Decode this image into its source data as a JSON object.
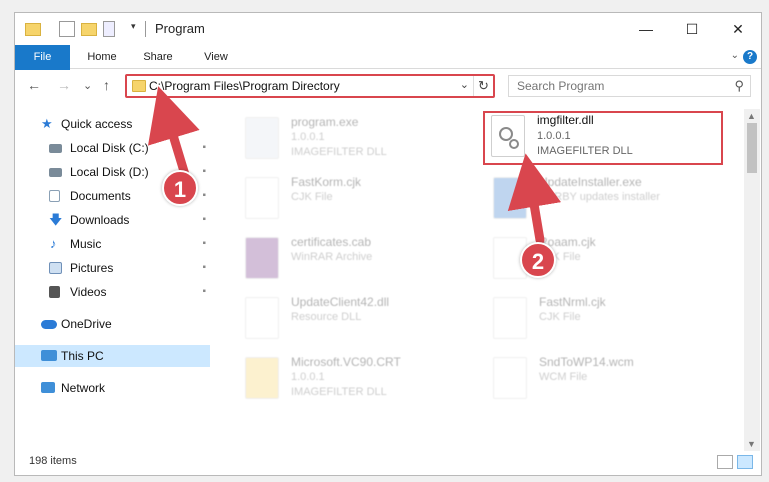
{
  "window": {
    "title": "Program",
    "buttons": {
      "minimize": "—",
      "maximize": "☐",
      "close": "✕"
    }
  },
  "ribbon": {
    "tabs": [
      "File",
      "Home",
      "Share",
      "View"
    ],
    "expand": "⌄",
    "help": "?"
  },
  "nav": {
    "back": "←",
    "forward": "→",
    "recent": "⌄",
    "up": "↑",
    "address": "C:\\Program Files\\Program Directory",
    "dropdown": "⌄",
    "refresh": "↻"
  },
  "search": {
    "placeholder": "Search Program",
    "icon": "⚲"
  },
  "sidebar": {
    "items": [
      {
        "label": "Quick access",
        "icon": "star-icon",
        "color": "#2b7bd6",
        "pinned": false
      },
      {
        "label": "Local Disk (C:)",
        "icon": "drive-icon",
        "color": "#7a8b99",
        "pinned": true
      },
      {
        "label": "Local Disk (D:)",
        "icon": "drive-icon",
        "color": "#7a8b99",
        "pinned": true
      },
      {
        "label": "Documents",
        "icon": "documents-icon",
        "color": "#8aa0b5",
        "pinned": true
      },
      {
        "label": "Downloads",
        "icon": "downloads-icon",
        "color": "#2b7bd6",
        "pinned": true
      },
      {
        "label": "Music",
        "icon": "music-icon",
        "color": "#2b7bd6",
        "pinned": true
      },
      {
        "label": "Pictures",
        "icon": "pictures-icon",
        "color": "#6f90b8",
        "pinned": true
      },
      {
        "label": "Videos",
        "icon": "videos-icon",
        "color": "#555555",
        "pinned": true
      },
      {
        "label": "OneDrive",
        "icon": "cloud-icon",
        "color": "#2b7bd6",
        "pinned": false
      },
      {
        "label": "This PC",
        "icon": "pc-icon",
        "color": "#3f8fd8",
        "pinned": false
      },
      {
        "label": "Network",
        "icon": "network-icon",
        "color": "#3f8fd8",
        "pinned": false
      }
    ],
    "pin_glyph": "📌"
  },
  "files": [
    {
      "name": "program.exe",
      "line2": "1.0.0.1",
      "line3": "IMAGEFILTER DLL",
      "icon": "exe-icon"
    },
    {
      "name": "imgfilter.dll",
      "line2": "1.0.0.1",
      "line3": "IMAGEFILTER DLL",
      "icon": "dll-gear-icon"
    },
    {
      "name": "FastKorm.cjk",
      "line2": "CJK File",
      "line3": "",
      "icon": "blank-file-icon"
    },
    {
      "name": "UpdateInstaller.exe",
      "line2": "RARBY updates installer",
      "line3": "",
      "icon": "installer-icon"
    },
    {
      "name": "certificates.cab",
      "line2": "WinRAR Archive",
      "line3": "",
      "icon": "archive-icon"
    },
    {
      "name": "Roaam.cjk",
      "line2": "CJK File",
      "line3": "",
      "icon": "blank-file-icon"
    },
    {
      "name": "UpdateClient42.dll",
      "line2": "Resource DLL",
      "line3": "",
      "icon": "dll-gear-icon"
    },
    {
      "name": "FastNrml.cjk",
      "line2": "CJK File",
      "line3": "",
      "icon": "blank-file-icon"
    },
    {
      "name": "Microsoft.VC90.CRT",
      "line2": "1.0.0.1",
      "line3": "IMAGEFILTER DLL",
      "icon": "folder-file-icon"
    },
    {
      "name": "SndToWP14.wcm",
      "line2": "WCM File",
      "line3": "",
      "icon": "blank-file-icon"
    }
  ],
  "status": {
    "items": "198 items"
  },
  "annotations": {
    "step1": "1",
    "step2": "2"
  },
  "colors": {
    "accent": "#1979ca",
    "highlight": "#d9464e",
    "selected": "#cce8ff"
  }
}
